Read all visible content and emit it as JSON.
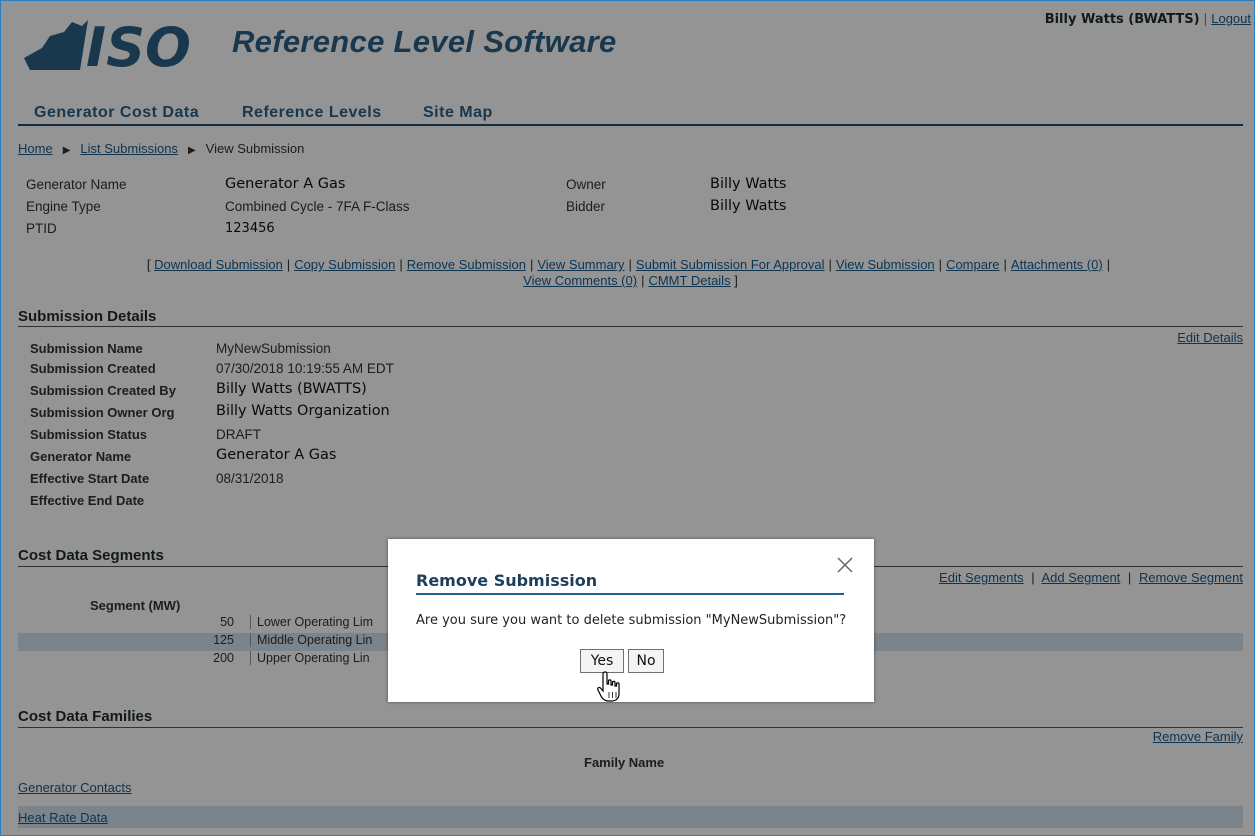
{
  "header": {
    "app_title": "Reference Level Software",
    "logo_text": "ISO",
    "user": "Billy Watts (BWATTS)",
    "separator": "|",
    "logout": "Logout"
  },
  "nav": [
    "Generator Cost Data",
    "Reference Levels",
    "Site Map"
  ],
  "breadcrumb": {
    "home": "Home",
    "list": "List Submissions",
    "current": "View Submission"
  },
  "generator": {
    "name_label": "Generator Name",
    "name_value": "Generator A Gas",
    "engine_label": "Engine Type",
    "engine_value": "Combined Cycle - 7FA F-Class",
    "ptid_label": "PTID",
    "ptid_value": "123456",
    "owner_label": "Owner",
    "owner_value": "Billy Watts",
    "bidder_label": "Bidder",
    "bidder_value": "Billy Watts"
  },
  "actions": {
    "open_bracket": "[",
    "close_bracket": "]",
    "sep": "|",
    "download": "Download Submission",
    "copy": "Copy Submission",
    "remove": "Remove Submission",
    "view_summary": "View Summary",
    "submit": "Submit Submission For Approval",
    "view_submission": "View Submission",
    "compare": "Compare",
    "attachments": "Attachments (0)",
    "view_comments": "View Comments (0)",
    "cmmt": "CMMT Details"
  },
  "submission_details": {
    "title": "Submission Details",
    "edit": "Edit Details",
    "name_label": "Submission Name",
    "name_value": "MyNewSubmission",
    "created_label": "Submission Created",
    "created_value": "07/30/2018 10:19:55 AM EDT",
    "created_by_label": "Submission Created By",
    "created_by_value": "Billy Watts (BWATTS)",
    "owner_org_label": "Submission Owner Org",
    "owner_org_value": "Billy Watts Organization",
    "status_label": "Submission Status",
    "status_value": "DRAFT",
    "generator_label": "Generator Name",
    "generator_value": "Generator A Gas",
    "start_label": "Effective Start Date",
    "start_value": "08/31/2018",
    "end_label": "Effective End Date"
  },
  "cost_segments": {
    "title": "Cost Data Segments",
    "edit": "Edit Segments",
    "add": "Add Segment",
    "remove": "Remove Segment",
    "sep": "|",
    "col_header": "Segment (MW)",
    "rows": [
      {
        "mw": "50",
        "name": "Lower Operating Lim"
      },
      {
        "mw": "125",
        "name": "Middle Operating Lin"
      },
      {
        "mw": "200",
        "name": "Upper Operating Lin"
      }
    ]
  },
  "cost_families": {
    "title": "Cost Data Families",
    "remove": "Remove Family",
    "col_header": "Family Name",
    "rows": [
      "Generator Contacts",
      "Heat Rate Data"
    ]
  },
  "modal": {
    "title": "Remove Submission",
    "message": "Are you sure you want to delete submission \"MyNewSubmission\"?",
    "yes": "Yes",
    "no": "No"
  },
  "colors": {
    "accent": "#2b5f86",
    "link": "#1a5a8a",
    "row_alt": "#d4e3ee",
    "overlay": "rgba(0,0,0,0.42)"
  }
}
